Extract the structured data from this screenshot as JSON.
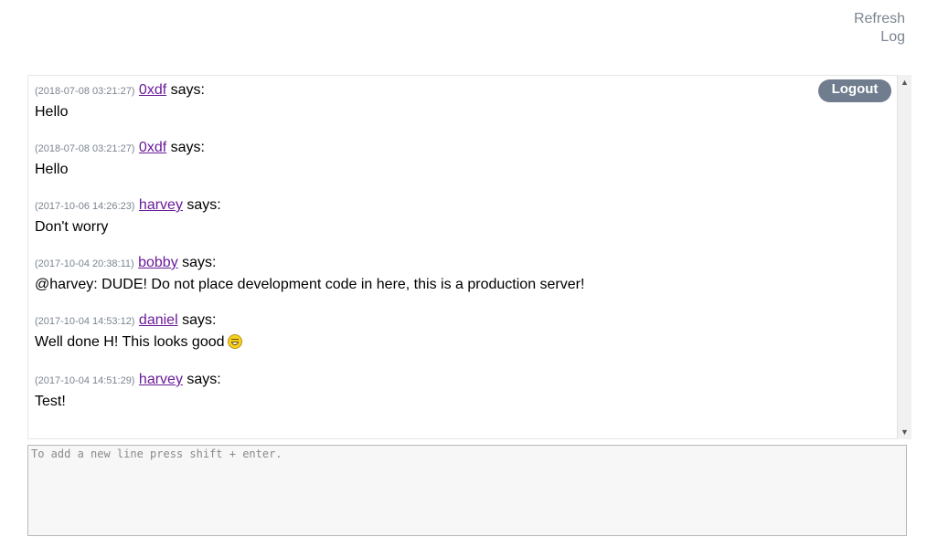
{
  "top_links": {
    "refresh": "Refresh",
    "log": "Log"
  },
  "logout_label": "Logout",
  "compose": {
    "placeholder": "To add a new line press shift + enter.",
    "value": ""
  },
  "messages": [
    {
      "timestamp": "(2018-07-08 03:21:27)",
      "user": "0xdf",
      "says": "says:",
      "text": "Hello"
    },
    {
      "timestamp": "(2018-07-08 03:21:27)",
      "user": "0xdf",
      "says": "says:",
      "text": "Hello"
    },
    {
      "timestamp": "(2017-10-06 14:26:23)",
      "user": "harvey",
      "says": "says:",
      "text": "Don't worry"
    },
    {
      "timestamp": "(2017-10-04 20:38:11)",
      "user": "bobby",
      "says": "says:",
      "text": "@harvey: DUDE! Do not place development code in here, this is a production server!"
    },
    {
      "timestamp": "(2017-10-04 14:53:12)",
      "user": "daniel",
      "says": "says:",
      "text": "Well done H! This looks good",
      "emoji": "laughing-smiley-icon"
    },
    {
      "timestamp": "(2017-10-04 14:51:29)",
      "user": "harvey",
      "says": "says:",
      "text": "Test!"
    }
  ],
  "colors": {
    "link_gray": "#7b8591",
    "username_purple": "#6a1b9a",
    "logout_bg": "#6f7d8e"
  }
}
